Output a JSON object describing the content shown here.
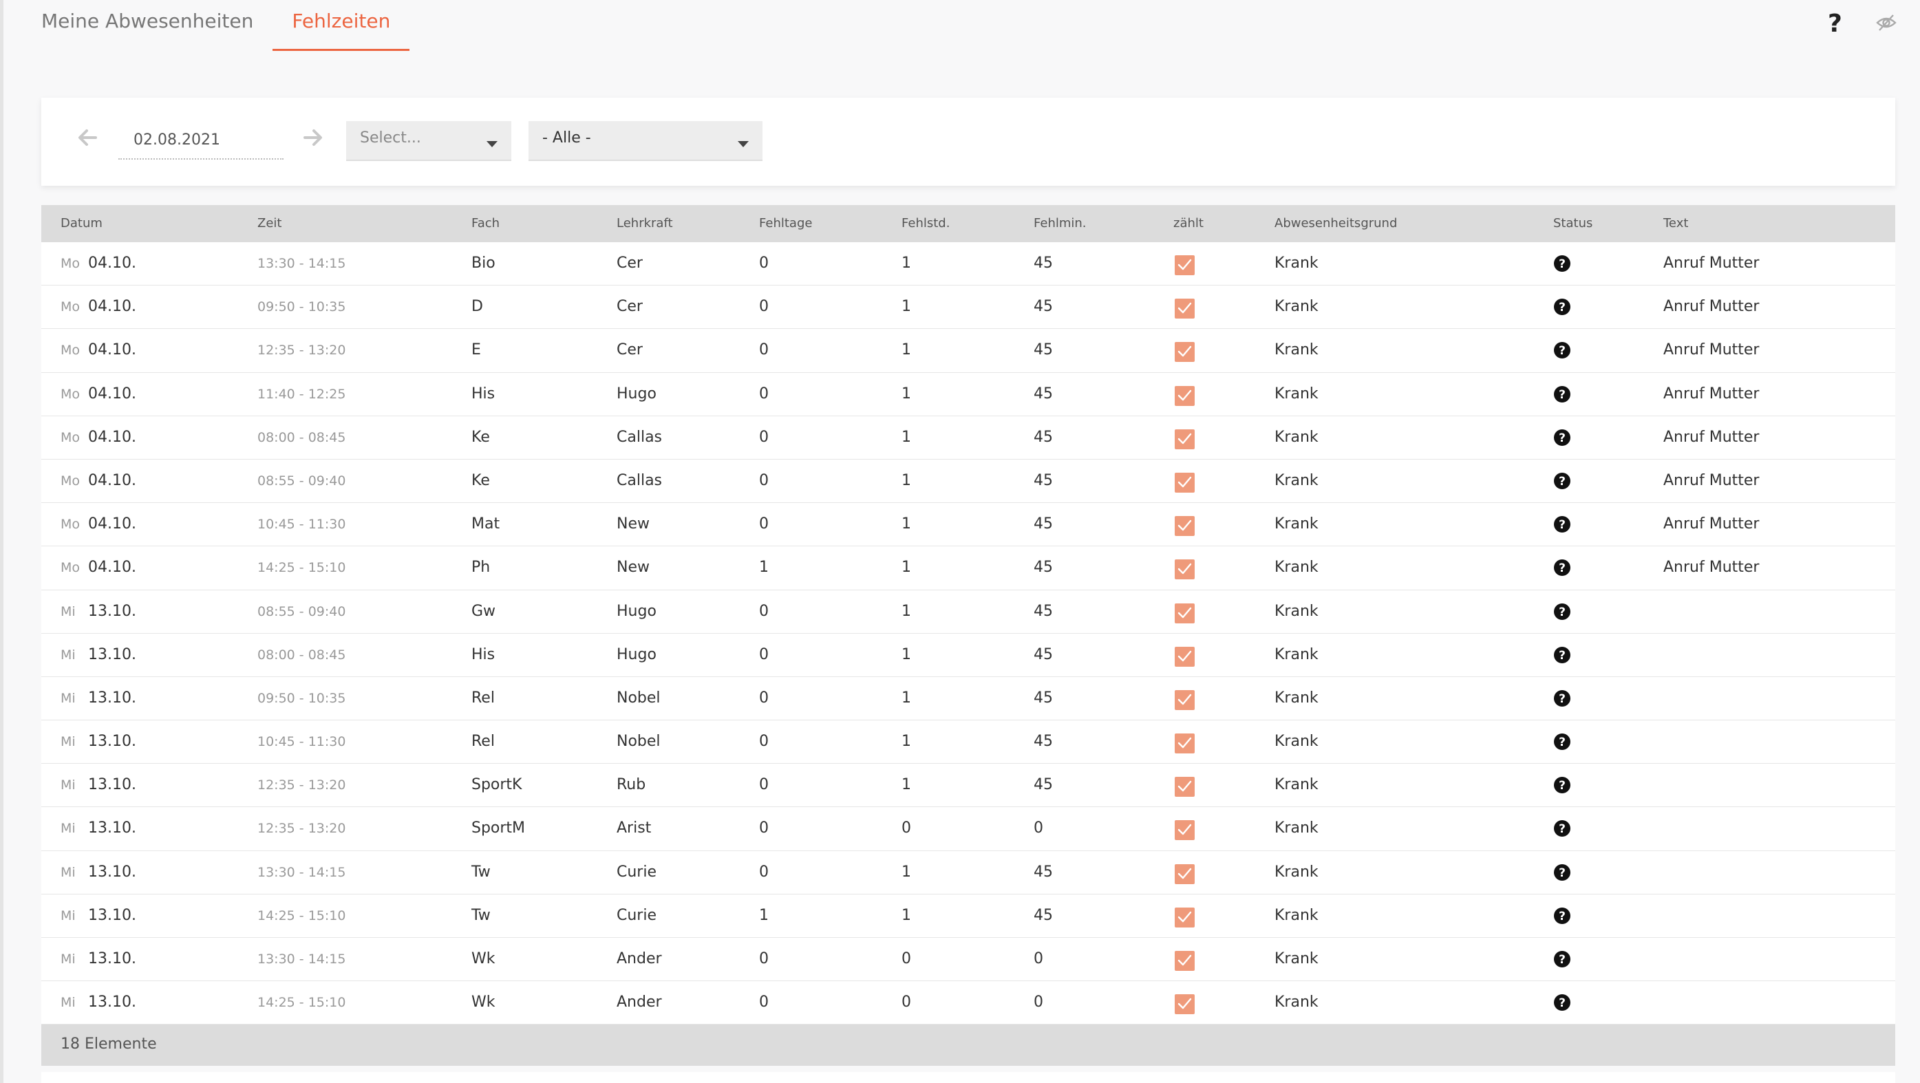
{
  "tabs": [
    {
      "label": "Meine Abwesenheiten",
      "active": false
    },
    {
      "label": "Fehlzeiten",
      "active": true
    }
  ],
  "header_icons": {
    "help": "?",
    "help_icon": "question-mark-icon",
    "visibility_icon": "eye-slash-icon"
  },
  "filter": {
    "date_value": "02.08.2021",
    "select1_placeholder": "Select...",
    "select2_value": "- Alle -"
  },
  "table": {
    "columns": [
      "Datum",
      "Zeit",
      "Fach",
      "Lehrkraft",
      "Fehltage",
      "Fehlstd.",
      "Fehlmin.",
      "zählt",
      "Abwesenheitsgrund",
      "Status",
      "Text"
    ],
    "rows": [
      {
        "day": "Mo",
        "date": "04.10.",
        "time": "13:30 - 14:15",
        "fach": "Bio",
        "lehrkraft": "Cer",
        "fehltage": "0",
        "fehlstd": "1",
        "fehlmin": "45",
        "zaehlt": true,
        "grund": "Krank",
        "text": "Anruf Mutter"
      },
      {
        "day": "Mo",
        "date": "04.10.",
        "time": "09:50 - 10:35",
        "fach": "D",
        "lehrkraft": "Cer",
        "fehltage": "0",
        "fehlstd": "1",
        "fehlmin": "45",
        "zaehlt": true,
        "grund": "Krank",
        "text": "Anruf Mutter"
      },
      {
        "day": "Mo",
        "date": "04.10.",
        "time": "12:35 - 13:20",
        "fach": "E",
        "lehrkraft": "Cer",
        "fehltage": "0",
        "fehlstd": "1",
        "fehlmin": "45",
        "zaehlt": true,
        "grund": "Krank",
        "text": "Anruf Mutter"
      },
      {
        "day": "Mo",
        "date": "04.10.",
        "time": "11:40 - 12:25",
        "fach": "His",
        "lehrkraft": "Hugo",
        "fehltage": "0",
        "fehlstd": "1",
        "fehlmin": "45",
        "zaehlt": true,
        "grund": "Krank",
        "text": "Anruf Mutter"
      },
      {
        "day": "Mo",
        "date": "04.10.",
        "time": "08:00 - 08:45",
        "fach": "Ke",
        "lehrkraft": "Callas",
        "fehltage": "0",
        "fehlstd": "1",
        "fehlmin": "45",
        "zaehlt": true,
        "grund": "Krank",
        "text": "Anruf Mutter"
      },
      {
        "day": "Mo",
        "date": "04.10.",
        "time": "08:55 - 09:40",
        "fach": "Ke",
        "lehrkraft": "Callas",
        "fehltage": "0",
        "fehlstd": "1",
        "fehlmin": "45",
        "zaehlt": true,
        "grund": "Krank",
        "text": "Anruf Mutter"
      },
      {
        "day": "Mo",
        "date": "04.10.",
        "time": "10:45 - 11:30",
        "fach": "Mat",
        "lehrkraft": "New",
        "fehltage": "0",
        "fehlstd": "1",
        "fehlmin": "45",
        "zaehlt": true,
        "grund": "Krank",
        "text": "Anruf Mutter"
      },
      {
        "day": "Mo",
        "date": "04.10.",
        "time": "14:25 - 15:10",
        "fach": "Ph",
        "lehrkraft": "New",
        "fehltage": "1",
        "fehlstd": "1",
        "fehlmin": "45",
        "zaehlt": true,
        "grund": "Krank",
        "text": "Anruf Mutter"
      },
      {
        "day": "Mi",
        "date": "13.10.",
        "time": "08:55 - 09:40",
        "fach": "Gw",
        "lehrkraft": "Hugo",
        "fehltage": "0",
        "fehlstd": "1",
        "fehlmin": "45",
        "zaehlt": true,
        "grund": "Krank",
        "text": ""
      },
      {
        "day": "Mi",
        "date": "13.10.",
        "time": "08:00 - 08:45",
        "fach": "His",
        "lehrkraft": "Hugo",
        "fehltage": "0",
        "fehlstd": "1",
        "fehlmin": "45",
        "zaehlt": true,
        "grund": "Krank",
        "text": ""
      },
      {
        "day": "Mi",
        "date": "13.10.",
        "time": "09:50 - 10:35",
        "fach": "Rel",
        "lehrkraft": "Nobel",
        "fehltage": "0",
        "fehlstd": "1",
        "fehlmin": "45",
        "zaehlt": true,
        "grund": "Krank",
        "text": ""
      },
      {
        "day": "Mi",
        "date": "13.10.",
        "time": "10:45 - 11:30",
        "fach": "Rel",
        "lehrkraft": "Nobel",
        "fehltage": "0",
        "fehlstd": "1",
        "fehlmin": "45",
        "zaehlt": true,
        "grund": "Krank",
        "text": ""
      },
      {
        "day": "Mi",
        "date": "13.10.",
        "time": "12:35 - 13:20",
        "fach": "SportK",
        "lehrkraft": "Rub",
        "fehltage": "0",
        "fehlstd": "1",
        "fehlmin": "45",
        "zaehlt": true,
        "grund": "Krank",
        "text": ""
      },
      {
        "day": "Mi",
        "date": "13.10.",
        "time": "12:35 - 13:20",
        "fach": "SportM",
        "lehrkraft": "Arist",
        "fehltage": "0",
        "fehlstd": "0",
        "fehlmin": "0",
        "zaehlt": true,
        "grund": "Krank",
        "text": ""
      },
      {
        "day": "Mi",
        "date": "13.10.",
        "time": "13:30 - 14:15",
        "fach": "Tw",
        "lehrkraft": "Curie",
        "fehltage": "0",
        "fehlstd": "1",
        "fehlmin": "45",
        "zaehlt": true,
        "grund": "Krank",
        "text": ""
      },
      {
        "day": "Mi",
        "date": "13.10.",
        "time": "14:25 - 15:10",
        "fach": "Tw",
        "lehrkraft": "Curie",
        "fehltage": "1",
        "fehlstd": "1",
        "fehlmin": "45",
        "zaehlt": true,
        "grund": "Krank",
        "text": ""
      },
      {
        "day": "Mi",
        "date": "13.10.",
        "time": "13:30 - 14:15",
        "fach": "Wk",
        "lehrkraft": "Ander",
        "fehltage": "0",
        "fehlstd": "0",
        "fehlmin": "0",
        "zaehlt": true,
        "grund": "Krank",
        "text": ""
      },
      {
        "day": "Mi",
        "date": "13.10.",
        "time": "14:25 - 15:10",
        "fach": "Wk",
        "lehrkraft": "Ander",
        "fehltage": "0",
        "fehlstd": "0",
        "fehlmin": "0",
        "zaehlt": true,
        "grund": "Krank",
        "text": ""
      }
    ],
    "footer": "18 Elemente"
  },
  "colors": {
    "accent": "#ec6541",
    "checkbox": "#ef9a7a",
    "header_bg": "#dcdcdc"
  }
}
